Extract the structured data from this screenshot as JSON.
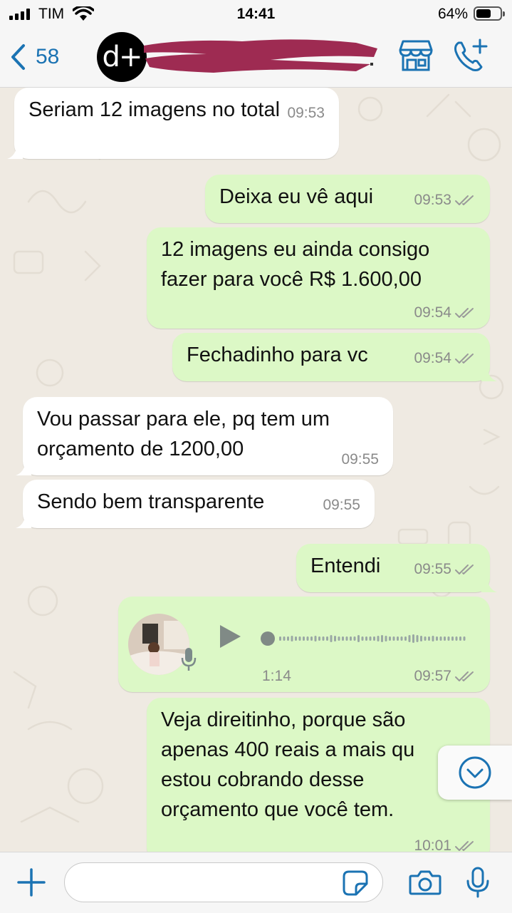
{
  "status_bar": {
    "carrier": "TIM",
    "time": "14:41",
    "battery": "64%",
    "battery_level": 0.64
  },
  "header": {
    "back_count": "58",
    "avatar_text": "d+"
  },
  "messages": [
    {
      "dir": "in",
      "text": [
        "Seriam 12 imagens no total"
      ],
      "time": "09:53"
    },
    {
      "dir": "out",
      "text": [
        "Deixa eu vê aqui"
      ],
      "time": "09:53"
    },
    {
      "dir": "out",
      "text": [
        "12 imagens eu ainda consigo",
        "fazer para você R$ 1.600,00"
      ],
      "time": "09:54"
    },
    {
      "dir": "out",
      "text": [
        "Fechadinho para vc"
      ],
      "time": "09:54"
    },
    {
      "dir": "in",
      "text": [
        "Vou passar para ele, pq tem um",
        "orçamento de 1200,00"
      ],
      "time": "09:55"
    },
    {
      "dir": "in",
      "text": [
        "Sendo bem transparente"
      ],
      "time": "09:55"
    },
    {
      "dir": "out",
      "text": [
        "Entendi"
      ],
      "time": "09:55"
    },
    {
      "dir": "out",
      "type": "voice",
      "duration": "1:14",
      "time": "09:57"
    },
    {
      "dir": "out",
      "text": [
        "Veja direitinho, porque são",
        "apenas 400 reais a mais qu",
        "estou cobrando desse",
        "orçamento que você tem."
      ],
      "time": "10:01"
    }
  ],
  "input": {
    "placeholder": ""
  },
  "colors": {
    "incoming": "#ffffff",
    "outgoing": "#dcf8c6",
    "accent": "#1b73b3",
    "background": "#efeae2"
  }
}
